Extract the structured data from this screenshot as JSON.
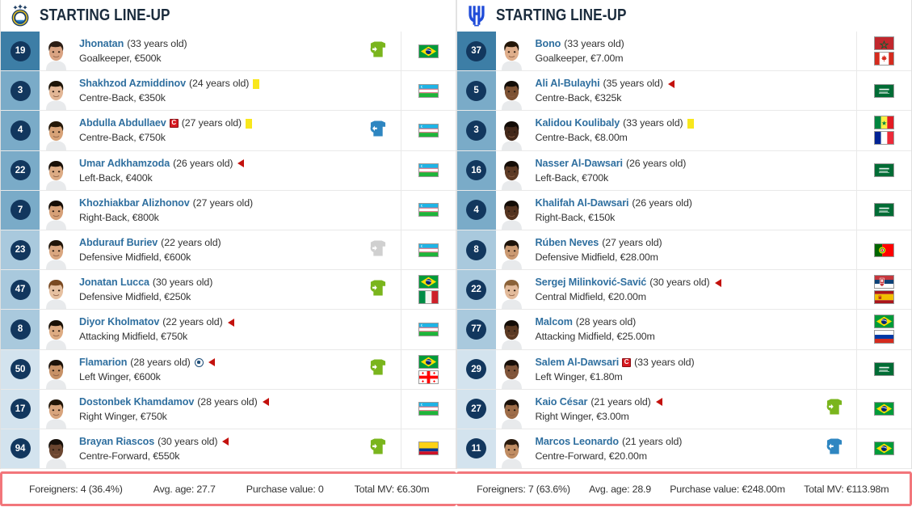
{
  "teams": [
    {
      "header_title": "STARTING LINE-UP",
      "logo_name": "pakhtakor-club-logo",
      "players": [
        {
          "number": "19",
          "name": "Jhonatan",
          "age": "(33 years old)",
          "position_value": "Goalkeeper, €500k",
          "captain": false,
          "yellow_card": false,
          "goal": false,
          "arrow_out": false,
          "sub": "in",
          "flags": [
            "br"
          ],
          "shade": "gk",
          "skin": "#d9a382",
          "hair": "#2b1d14"
        },
        {
          "number": "3",
          "name": "Shakhzod Azmiddinov",
          "age": "(24 years old)",
          "position_value": "Centre-Back, €350k",
          "captain": false,
          "yellow_card": true,
          "goal": false,
          "arrow_out": false,
          "sub": "none",
          "flags": [
            "uz"
          ],
          "shade": "def",
          "skin": "#e2b695",
          "hair": "#1d1408"
        },
        {
          "number": "4",
          "name": "Abdulla Abdullaev",
          "age": "(27 years old)",
          "position_value": "Centre-Back, €750k",
          "captain": true,
          "yellow_card": true,
          "goal": false,
          "arrow_out": false,
          "sub": "out",
          "flags": [
            "uz"
          ],
          "shade": "def",
          "skin": "#d7a277",
          "hair": "#241708"
        },
        {
          "number": "22",
          "name": "Umar Adkhamzoda",
          "age": "(26 years old)",
          "position_value": "Left-Back, €400k",
          "captain": false,
          "yellow_card": false,
          "goal": false,
          "arrow_out": true,
          "sub": "none",
          "flags": [
            "uz"
          ],
          "shade": "def",
          "skin": "#dcab84",
          "hair": "#191008"
        },
        {
          "number": "7",
          "name": "Khozhiakbar Alizhonov",
          "age": "(27 years old)",
          "position_value": "Right-Back, €800k",
          "captain": false,
          "yellow_card": false,
          "goal": false,
          "arrow_out": false,
          "sub": "none",
          "flags": [
            "uz"
          ],
          "shade": "def",
          "skin": "#d6a077",
          "hair": "#150d06"
        },
        {
          "number": "23",
          "name": "Abdurauf Buriev",
          "age": "(22 years old)",
          "position_value": "Defensive Midfield, €600k",
          "captain": false,
          "yellow_card": false,
          "goal": false,
          "arrow_out": false,
          "sub": "grey",
          "flags": [
            "uz"
          ],
          "shade": "mid",
          "skin": "#d9a67f",
          "hair": "#201509"
        },
        {
          "number": "47",
          "name": "Jonatan Lucca",
          "age": "(30 years old)",
          "position_value": "Defensive Midfield, €250k",
          "captain": false,
          "yellow_card": false,
          "goal": false,
          "arrow_out": false,
          "sub": "in",
          "flags": [
            "br",
            "it"
          ],
          "shade": "mid",
          "skin": "#e6c0a0",
          "hair": "#7a4a22"
        },
        {
          "number": "8",
          "name": "Diyor Kholmatov",
          "age": "(22 years old)",
          "position_value": "Attacking Midfield, €750k",
          "captain": false,
          "yellow_card": false,
          "goal": false,
          "arrow_out": true,
          "sub": "none",
          "flags": [
            "uz"
          ],
          "shade": "mid",
          "skin": "#ddab82",
          "hair": "#1a1107"
        },
        {
          "number": "50",
          "name": "Flamarion",
          "age": "(28 years old)",
          "position_value": "Left Winger, €600k",
          "captain": false,
          "yellow_card": false,
          "goal": true,
          "arrow_out": true,
          "sub": "in",
          "flags": [
            "br",
            "ge"
          ],
          "shade": "att",
          "skin": "#c79166",
          "hair": "#1b1109"
        },
        {
          "number": "17",
          "name": "Dostonbek Khamdamov",
          "age": "(28 years old)",
          "position_value": "Right Winger, €750k",
          "captain": false,
          "yellow_card": false,
          "goal": false,
          "arrow_out": true,
          "sub": "none",
          "flags": [
            "uz"
          ],
          "shade": "att",
          "skin": "#d8a47c",
          "hair": "#201407"
        },
        {
          "number": "94",
          "name": "Brayan Riascos",
          "age": "(30 years old)",
          "position_value": "Centre-Forward, €550k",
          "captain": false,
          "yellow_card": false,
          "goal": false,
          "arrow_out": true,
          "sub": "in",
          "flags": [
            "co"
          ],
          "shade": "att",
          "skin": "#6b4630",
          "hair": "#17100a"
        }
      ],
      "footer": {
        "foreigners": "Foreigners: 4 (36.4%)",
        "avg_age": "Avg. age: 27.7",
        "purchase_value": "Purchase value: 0",
        "total_mv": "Total MV: €6.30m"
      }
    },
    {
      "header_title": "STARTING LINE-UP",
      "logo_name": "al-hilal-club-logo",
      "players": [
        {
          "number": "37",
          "name": "Bono",
          "age": "(33 years old)",
          "position_value": "Goalkeeper, €7.00m",
          "captain": false,
          "yellow_card": false,
          "goal": false,
          "arrow_out": false,
          "sub": "none",
          "flags": [
            "ma",
            "ca"
          ],
          "shade": "gk",
          "skin": "#dfae8b",
          "hair": "#231608"
        },
        {
          "number": "5",
          "name": "Ali Al-Bulayhi",
          "age": "(35 years old)",
          "position_value": "Centre-Back, €325k",
          "captain": false,
          "yellow_card": false,
          "goal": false,
          "arrow_out": true,
          "sub": "none",
          "flags": [
            "sa"
          ],
          "shade": "def",
          "skin": "#7d5233",
          "hair": "#120c06"
        },
        {
          "number": "3",
          "name": "Kalidou Koulibaly",
          "age": "(33 years old)",
          "position_value": "Centre-Back, €8.00m",
          "captain": false,
          "yellow_card": true,
          "goal": false,
          "arrow_out": false,
          "sub": "none",
          "flags": [
            "sn",
            "fr"
          ],
          "shade": "def",
          "skin": "#43281a",
          "hair": "#120b06"
        },
        {
          "number": "16",
          "name": "Nasser Al-Dawsari",
          "age": "(26 years old)",
          "position_value": "Left-Back, €700k",
          "captain": false,
          "yellow_card": false,
          "goal": false,
          "arrow_out": false,
          "sub": "none",
          "flags": [
            "sa"
          ],
          "shade": "def",
          "skin": "#5e3b25",
          "hair": "#150d07"
        },
        {
          "number": "4",
          "name": "Khalifah Al-Dawsari",
          "age": "(26 years old)",
          "position_value": "Right-Back, €150k",
          "captain": false,
          "yellow_card": false,
          "goal": false,
          "arrow_out": false,
          "sub": "none",
          "flags": [
            "sa"
          ],
          "shade": "def",
          "skin": "#553420",
          "hair": "#130c06"
        },
        {
          "number": "8",
          "name": "Rúben Neves",
          "age": "(27 years old)",
          "position_value": "Defensive Midfield, €28.00m",
          "captain": false,
          "yellow_card": false,
          "goal": false,
          "arrow_out": false,
          "sub": "none",
          "flags": [
            "pt"
          ],
          "shade": "mid",
          "skin": "#cb9a72",
          "hair": "#1d1209"
        },
        {
          "number": "22",
          "name": "Sergej Milinković-Savić",
          "age": "(30 years old)",
          "position_value": "Central Midfield, €20.00m",
          "captain": false,
          "yellow_card": false,
          "goal": false,
          "arrow_out": true,
          "sub": "none",
          "flags": [
            "rs",
            "es"
          ],
          "shade": "mid",
          "skin": "#e3bb9b",
          "hair": "#8b6238"
        },
        {
          "number": "77",
          "name": "Malcom",
          "age": "(28 years old)",
          "position_value": "Attacking Midfield, €25.00m",
          "captain": false,
          "yellow_card": false,
          "goal": false,
          "arrow_out": false,
          "sub": "none",
          "flags": [
            "br",
            "ru"
          ],
          "shade": "mid",
          "skin": "#5b3a23",
          "hair": "#140d07"
        },
        {
          "number": "29",
          "name": "Salem Al-Dawsari",
          "age": "(33 years old)",
          "position_value": "Left Winger, €1.80m",
          "captain": true,
          "yellow_card": false,
          "goal": false,
          "arrow_out": false,
          "sub": "none",
          "flags": [
            "sa"
          ],
          "shade": "att",
          "skin": "#80553a",
          "hair": "#170e08"
        },
        {
          "number": "27",
          "name": "Kaio César",
          "age": "(21 years old)",
          "position_value": "Right Winger, €3.00m",
          "captain": false,
          "yellow_card": false,
          "goal": false,
          "arrow_out": true,
          "sub": "in",
          "flags": [
            "br"
          ],
          "shade": "att",
          "skin": "#9e6d49",
          "hair": "#1a1009"
        },
        {
          "number": "11",
          "name": "Marcos Leonardo",
          "age": "(21 years old)",
          "position_value": "Centre-Forward, €20.00m",
          "captain": false,
          "yellow_card": false,
          "goal": false,
          "arrow_out": false,
          "sub": "out",
          "flags": [
            "br"
          ],
          "shade": "att",
          "skin": "#c08d63",
          "hair": "#2a1a0c"
        }
      ],
      "footer": {
        "foreigners": "Foreigners: 7 (63.6%)",
        "avg_age": "Avg. age: 28.9",
        "purchase_value": "Purchase value: €248.00m",
        "total_mv": "Total MV: €113.98m"
      }
    }
  ],
  "colors": {
    "name_link": "#2f6f9f",
    "number_badge": "#12375e",
    "shade_gk": "#3d7ea6",
    "shade_def": "#7aabc8",
    "shade_mid": "#a9c9dd",
    "shade_att": "#d3e3ee",
    "sub_in": "#7ab51d",
    "sub_out": "#2e86c1",
    "sub_grey": "#d0d0d0",
    "yellow_card": "#f8e71c",
    "red_arrow": "#c3110d",
    "footer_border": "#f2767b"
  }
}
